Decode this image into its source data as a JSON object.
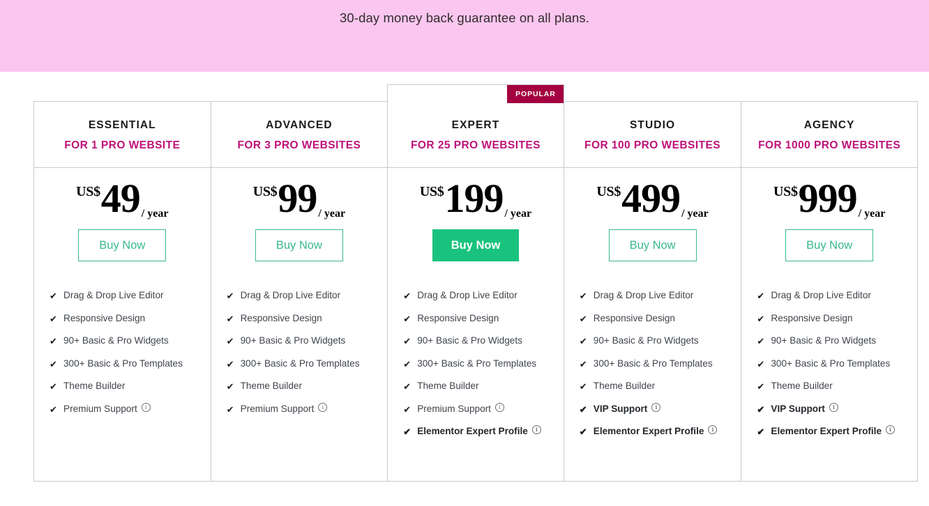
{
  "banner": {
    "text": "30-day money back guarantee on all plans.",
    "background": "#fbc6ef"
  },
  "badge": {
    "label": "POPULAR",
    "color": "#a3013f"
  },
  "colors": {
    "accent_magenta": "#bf1178",
    "button_green": "#39b98a",
    "button_green_solid": "#19c37d"
  },
  "plans": [
    {
      "name": "ESSENTIAL",
      "sub": "FOR 1 PRO WEBSITE",
      "currency": "US$",
      "amount": "49",
      "period": "/ year",
      "cta": "Buy Now",
      "featured": false,
      "features": [
        {
          "label": "Drag & Drop Live Editor",
          "bold": false,
          "info": false
        },
        {
          "label": "Responsive Design",
          "bold": false,
          "info": false
        },
        {
          "label": "90+ Basic & Pro Widgets",
          "bold": false,
          "info": false
        },
        {
          "label": "300+ Basic & Pro Templates",
          "bold": false,
          "info": false
        },
        {
          "label": "Theme Builder",
          "bold": false,
          "info": false
        },
        {
          "label": "Premium Support",
          "bold": false,
          "info": true
        }
      ]
    },
    {
      "name": "ADVANCED",
      "sub": "FOR 3 PRO WEBSITES",
      "currency": "US$",
      "amount": "99",
      "period": "/ year",
      "cta": "Buy Now",
      "featured": false,
      "features": [
        {
          "label": "Drag & Drop Live Editor",
          "bold": false,
          "info": false
        },
        {
          "label": "Responsive Design",
          "bold": false,
          "info": false
        },
        {
          "label": "90+ Basic & Pro Widgets",
          "bold": false,
          "info": false
        },
        {
          "label": "300+ Basic & Pro Templates",
          "bold": false,
          "info": false
        },
        {
          "label": "Theme Builder",
          "bold": false,
          "info": false
        },
        {
          "label": "Premium Support",
          "bold": false,
          "info": true
        }
      ]
    },
    {
      "name": "EXPERT",
      "sub": "FOR 25 PRO WEBSITES",
      "currency": "US$",
      "amount": "199",
      "period": "/ year",
      "cta": "Buy Now",
      "featured": true,
      "features": [
        {
          "label": "Drag & Drop Live Editor",
          "bold": false,
          "info": false
        },
        {
          "label": "Responsive Design",
          "bold": false,
          "info": false
        },
        {
          "label": "90+ Basic & Pro Widgets",
          "bold": false,
          "info": false
        },
        {
          "label": "300+ Basic & Pro Templates",
          "bold": false,
          "info": false
        },
        {
          "label": "Theme Builder",
          "bold": false,
          "info": false
        },
        {
          "label": "Premium Support",
          "bold": false,
          "info": true
        },
        {
          "label": "Elementor Expert Profile",
          "bold": true,
          "info": true
        }
      ]
    },
    {
      "name": "STUDIO",
      "sub": "FOR 100 PRO WEBSITES",
      "currency": "US$",
      "amount": "499",
      "period": "/ year",
      "cta": "Buy Now",
      "featured": false,
      "features": [
        {
          "label": "Drag & Drop Live Editor",
          "bold": false,
          "info": false
        },
        {
          "label": "Responsive Design",
          "bold": false,
          "info": false
        },
        {
          "label": "90+ Basic & Pro Widgets",
          "bold": false,
          "info": false
        },
        {
          "label": "300+ Basic & Pro Templates",
          "bold": false,
          "info": false
        },
        {
          "label": "Theme Builder",
          "bold": false,
          "info": false
        },
        {
          "label": "VIP Support",
          "bold": true,
          "info": true
        },
        {
          "label": "Elementor Expert Profile",
          "bold": true,
          "info": true
        }
      ]
    },
    {
      "name": "AGENCY",
      "sub": "FOR 1000 PRO WEBSITES",
      "currency": "US$",
      "amount": "999",
      "period": "/ year",
      "cta": "Buy Now",
      "featured": false,
      "features": [
        {
          "label": "Drag & Drop Live Editor",
          "bold": false,
          "info": false
        },
        {
          "label": "Responsive Design",
          "bold": false,
          "info": false
        },
        {
          "label": "90+ Basic & Pro Widgets",
          "bold": false,
          "info": false
        },
        {
          "label": "300+ Basic & Pro Templates",
          "bold": false,
          "info": false
        },
        {
          "label": "Theme Builder",
          "bold": false,
          "info": false
        },
        {
          "label": "VIP Support",
          "bold": true,
          "info": true
        },
        {
          "label": "Elementor Expert Profile",
          "bold": true,
          "info": true
        }
      ]
    }
  ]
}
